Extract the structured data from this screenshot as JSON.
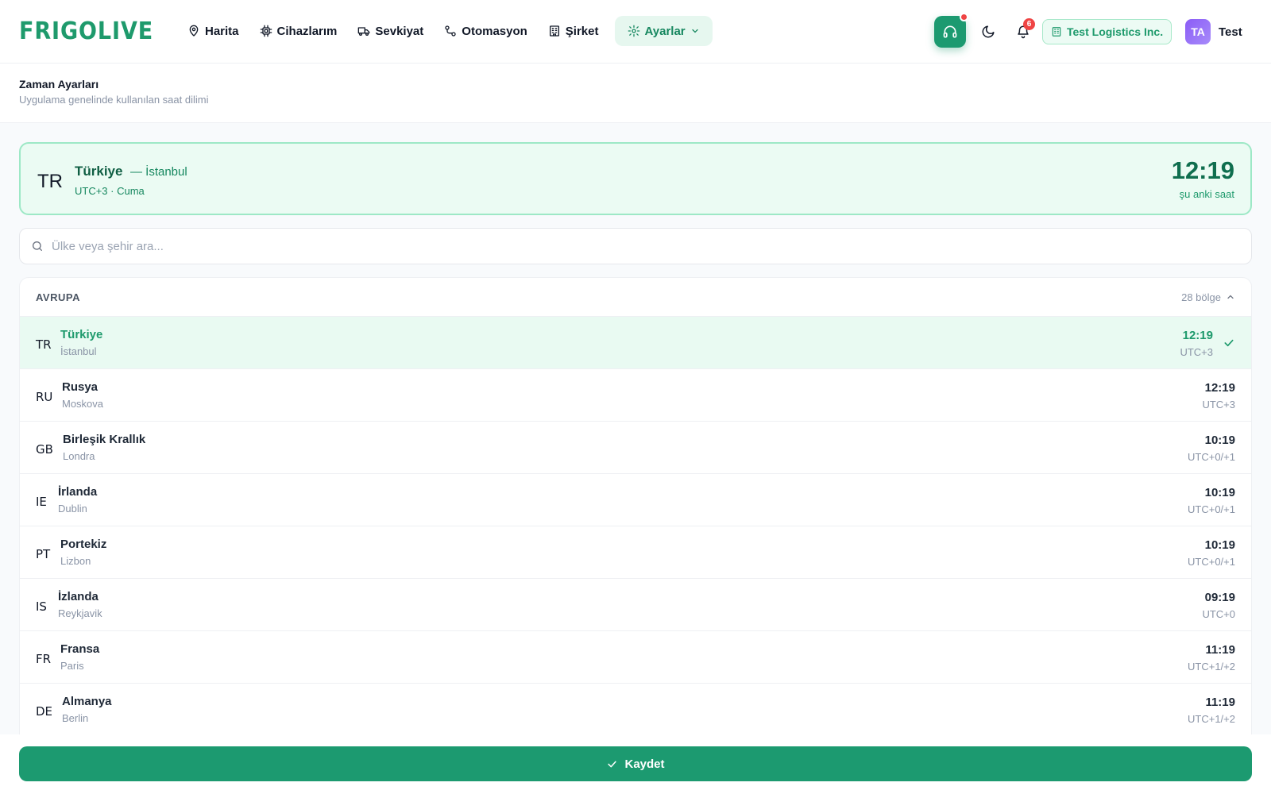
{
  "brand": {
    "name": "FRIGOLIVE",
    "color": "#1e9a6c"
  },
  "nav": {
    "items": [
      {
        "label": "Harita",
        "icon": "map-pin-icon"
      },
      {
        "label": "Cihazlarım",
        "icon": "chip-icon"
      },
      {
        "label": "Sevkiyat",
        "icon": "truck-icon"
      },
      {
        "label": "Otomasyon",
        "icon": "workflow-icon"
      },
      {
        "label": "Şirket",
        "icon": "building-icon"
      }
    ],
    "active": {
      "label": "Ayarlar",
      "icon": "gear-icon"
    }
  },
  "header": {
    "notifications_count": "6",
    "company": "Test Logistics Inc.",
    "user_initials": "TA",
    "user_name": "Test"
  },
  "page": {
    "title": "Zaman Ayarları",
    "subtitle": "Uygulama genelinde kullanılan saat dilimi"
  },
  "current": {
    "code": "TR",
    "country": "Türkiye",
    "city": "— İstanbul",
    "meta": "UTC+3 · Cuma",
    "time": "12:19",
    "time_label": "şu anki saat"
  },
  "search": {
    "placeholder": "Ülke veya şehir ara...",
    "value": ""
  },
  "region": {
    "name": "AVRUPA",
    "count": "28 bölge",
    "rows": [
      {
        "code": "TR",
        "country": "Türkiye",
        "city": "İstanbul",
        "time": "12:19",
        "utc": "UTC+3",
        "selected": true
      },
      {
        "code": "RU",
        "country": "Rusya",
        "city": "Moskova",
        "time": "12:19",
        "utc": "UTC+3"
      },
      {
        "code": "GB",
        "country": "Birleşik Krallık",
        "city": "Londra",
        "time": "10:19",
        "utc": "UTC+0/+1"
      },
      {
        "code": "IE",
        "country": "İrlanda",
        "city": "Dublin",
        "time": "10:19",
        "utc": "UTC+0/+1"
      },
      {
        "code": "PT",
        "country": "Portekiz",
        "city": "Lizbon",
        "time": "10:19",
        "utc": "UTC+0/+1"
      },
      {
        "code": "IS",
        "country": "İzlanda",
        "city": "Reykjavik",
        "time": "09:19",
        "utc": "UTC+0"
      },
      {
        "code": "FR",
        "country": "Fransa",
        "city": "Paris",
        "time": "11:19",
        "utc": "UTC+1/+2"
      },
      {
        "code": "DE",
        "country": "Almanya",
        "city": "Berlin",
        "time": "11:19",
        "utc": "UTC+1/+2"
      }
    ]
  },
  "save": {
    "label": "Kaydet"
  }
}
